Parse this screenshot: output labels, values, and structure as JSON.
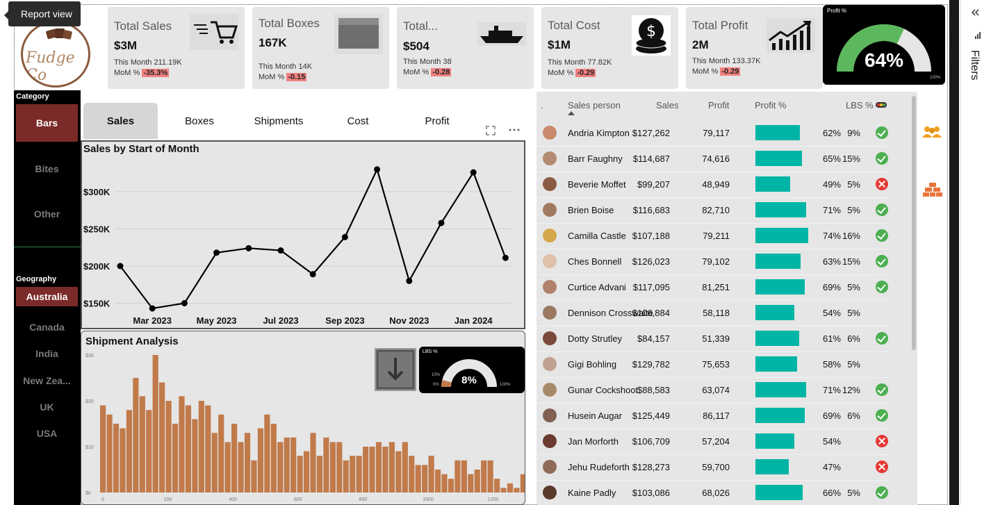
{
  "tooltip": "Report view",
  "logo_text": "Fudge Co",
  "kpis": [
    {
      "title": "Total Sales",
      "value": "$3M",
      "month": "This Month 211.19K",
      "mom_label": "MoM %",
      "mom": "-35.3%",
      "icon": "shopping-cart-icon"
    },
    {
      "title": "Total Boxes",
      "value": "167K",
      "month": "This Month 14K",
      "mom_label": "MoM %",
      "mom": "-0.15",
      "icon": "box-icon"
    },
    {
      "title": "Total...",
      "value": "$504",
      "month": "This Month 38",
      "mom_label": "MoM %",
      "mom": "-0.28",
      "icon": "ship-icon"
    },
    {
      "title": "Total Cost",
      "value": "$1M",
      "month": "This Month 77.82K",
      "mom_label": "MoM %",
      "mom": "-0.29",
      "icon": "coins-icon"
    },
    {
      "title": "Total Profit",
      "value": "2M",
      "month": "This Month 133.37K",
      "mom_label": "MoM %",
      "mom": "-0.29",
      "icon": "growth-chart-icon"
    }
  ],
  "profit_gauge": {
    "label": "Profit %",
    "value": "64%",
    "fraction": 0.64,
    "max_label": "100%"
  },
  "slicer": {
    "category_title": "Category",
    "categories": [
      "Bars",
      "Bites",
      "Other"
    ],
    "geography_title": "Geography",
    "geographies": [
      "Australia",
      "Canada",
      "India",
      "New Zea...",
      "UK",
      "USA"
    ]
  },
  "tabs": [
    "Sales",
    "Boxes",
    "Shipments",
    "Cost",
    "Profit"
  ],
  "sales_chart": {
    "title": "Sales by Start of Month",
    "y_ticks": [
      "$300K",
      "$250K",
      "$200K",
      "$150K"
    ],
    "x_ticks": [
      "Mar 2023",
      "May 2023",
      "Jul 2023",
      "Sep 2023",
      "Nov 2023",
      "Jan 2024"
    ]
  },
  "shipment": {
    "title": "Shipment Analysis",
    "y_ticks": [
      "$30",
      "$20",
      "$10",
      "$0"
    ],
    "x_ticks": [
      "0",
      "200",
      "400",
      "600",
      "800",
      "1000",
      "1200"
    ],
    "lbs_gauge": {
      "label": "LBS %",
      "value": "8%",
      "fraction": 0.08,
      "min_label": "0%",
      "mid_label": "10%",
      "max_label": "100%"
    }
  },
  "table": {
    "headers": {
      "sales_person": "Sales person",
      "sales": "Sales",
      "profit": "Profit",
      "profit_pct": "Profit %",
      "lbs_pct": "LBS %"
    },
    "rows": [
      {
        "name": "Andria Kimpton",
        "sales": "$127,262",
        "profit": "79,117",
        "profit_pct": "62%",
        "lbs": "9%",
        "status": "ok"
      },
      {
        "name": "Barr Faughny",
        "sales": "$114,687",
        "profit": "74,616",
        "profit_pct": "65%",
        "lbs": "15%",
        "status": "ok"
      },
      {
        "name": "Beverie Moffet",
        "sales": "$99,207",
        "profit": "48,949",
        "profit_pct": "49%",
        "lbs": "5%",
        "status": "bad"
      },
      {
        "name": "Brien Boise",
        "sales": "$116,683",
        "profit": "82,710",
        "profit_pct": "71%",
        "lbs": "5%",
        "status": "ok"
      },
      {
        "name": "Camilla Castle",
        "sales": "$107,188",
        "profit": "79,211",
        "profit_pct": "74%",
        "lbs": "16%",
        "status": "ok"
      },
      {
        "name": "Ches Bonnell",
        "sales": "$126,023",
        "profit": "79,102",
        "profit_pct": "63%",
        "lbs": "15%",
        "status": "ok"
      },
      {
        "name": "Curtice Advani",
        "sales": "$117,095",
        "profit": "81,251",
        "profit_pct": "69%",
        "lbs": "5%",
        "status": "ok"
      },
      {
        "name": "Dennison Crosswaite",
        "sales": "$106,884",
        "profit": "58,118",
        "profit_pct": "54%",
        "lbs": "5%",
        "status": "none"
      },
      {
        "name": "Dotty Strutley",
        "sales": "$84,157",
        "profit": "51,339",
        "profit_pct": "61%",
        "lbs": "6%",
        "status": "ok"
      },
      {
        "name": "Gigi Bohling",
        "sales": "$129,782",
        "profit": "75,653",
        "profit_pct": "58%",
        "lbs": "5%",
        "status": "none"
      },
      {
        "name": "Gunar Cockshoot",
        "sales": "$88,583",
        "profit": "63,074",
        "profit_pct": "71%",
        "lbs": "12%",
        "status": "ok"
      },
      {
        "name": "Husein Augar",
        "sales": "$125,449",
        "profit": "86,117",
        "profit_pct": "69%",
        "lbs": "6%",
        "status": "ok"
      },
      {
        "name": "Jan Morforth",
        "sales": "$106,709",
        "profit": "57,204",
        "profit_pct": "54%",
        "lbs": "",
        "status": "bad"
      },
      {
        "name": "Jehu Rudeforth",
        "sales": "$128,273",
        "profit": "59,700",
        "profit_pct": "47%",
        "lbs": "",
        "status": "bad"
      },
      {
        "name": "Kaine Padly",
        "sales": "$103,086",
        "profit": "68,026",
        "profit_pct": "66%",
        "lbs": "5%",
        "status": "ok"
      }
    ]
  },
  "filters_label": "Filters",
  "colors": {
    "accent_bar": "#00b5a5",
    "slicer_selected": "#7a2a28",
    "ship_bars": "#c17a4a",
    "gauge_green": "#5cb85c"
  },
  "chart_data": [
    {
      "type": "line",
      "title": "Sales by Start of Month",
      "x": [
        "Feb 2023",
        "Mar 2023",
        "Apr 2023",
        "May 2023",
        "Jun 2023",
        "Jul 2023",
        "Aug 2023",
        "Sep 2023",
        "Oct 2023",
        "Nov 2023",
        "Dec 2023",
        "Jan 2024",
        "Feb 2024"
      ],
      "values": [
        200000,
        143000,
        150000,
        218000,
        224000,
        221000,
        189000,
        239000,
        330000,
        180000,
        258000,
        326000,
        211000
      ],
      "ylim": [
        130000,
        340000
      ]
    },
    {
      "type": "bar",
      "title": "Shipment Analysis",
      "x_range": [
        0,
        1200
      ],
      "values": [
        19,
        17,
        15,
        14,
        18,
        25,
        21,
        18,
        30,
        24,
        20,
        15,
        21,
        19,
        16,
        20,
        19,
        13,
        17,
        11,
        15,
        11,
        13,
        7,
        14,
        17,
        15,
        11,
        12,
        12,
        8,
        9,
        13,
        8,
        12,
        11,
        11,
        7,
        8,
        8,
        10,
        10,
        11,
        10,
        11,
        9,
        11,
        8,
        6,
        6,
        8,
        5,
        4,
        3,
        7,
        7,
        4,
        5,
        7,
        7,
        3,
        1,
        2,
        1,
        4,
        2,
        3,
        1,
        1,
        1,
        1,
        1,
        1,
        2
      ]
    }
  ]
}
